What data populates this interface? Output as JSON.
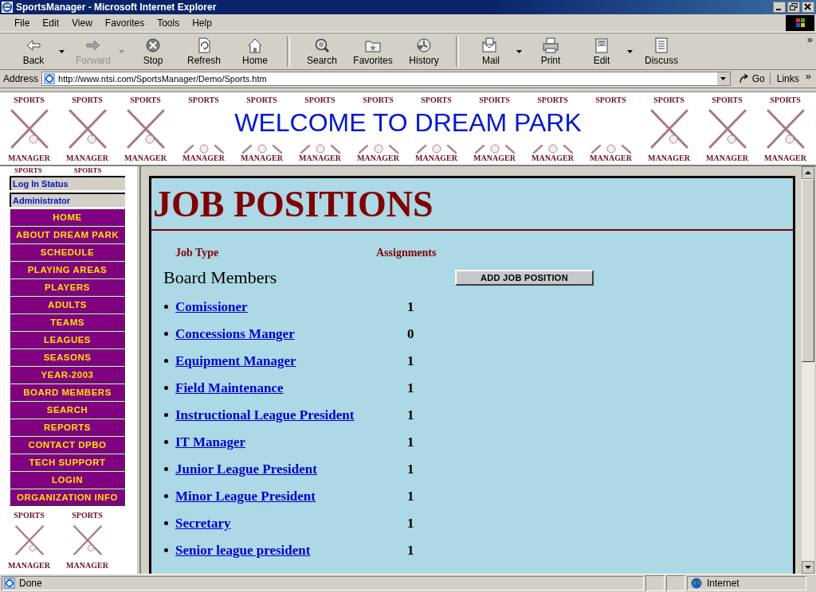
{
  "window": {
    "title": "SportsManager - Microsoft Internet Explorer"
  },
  "menu": [
    "File",
    "Edit",
    "View",
    "Favorites",
    "Tools",
    "Help"
  ],
  "toolbar": [
    {
      "label": "Back",
      "disabled": false,
      "dropdown": true,
      "group_end": false
    },
    {
      "label": "Forward",
      "disabled": true,
      "dropdown": true,
      "group_end": false
    },
    {
      "label": "Stop",
      "disabled": false,
      "dropdown": false,
      "group_end": false
    },
    {
      "label": "Refresh",
      "disabled": false,
      "dropdown": false,
      "group_end": false
    },
    {
      "label": "Home",
      "disabled": false,
      "dropdown": false,
      "group_end": true
    },
    {
      "label": "Search",
      "disabled": false,
      "dropdown": false,
      "group_end": false
    },
    {
      "label": "Favorites",
      "disabled": false,
      "dropdown": false,
      "group_end": false
    },
    {
      "label": "History",
      "disabled": false,
      "dropdown": false,
      "group_end": true
    },
    {
      "label": "Mail",
      "disabled": false,
      "dropdown": true,
      "group_end": false
    },
    {
      "label": "Print",
      "disabled": false,
      "dropdown": false,
      "group_end": false
    },
    {
      "label": "Edit",
      "disabled": false,
      "dropdown": true,
      "group_end": false
    },
    {
      "label": "Discuss",
      "disabled": false,
      "dropdown": false,
      "group_end": false
    }
  ],
  "toolbar_more": "»",
  "address_bar": {
    "label": "Address",
    "value": "http://www.ntsi.com/SportsManager/Demo/Sports.htm",
    "go": "Go",
    "links": "Links",
    "links_more": "»"
  },
  "banner": {
    "title": "WELCOME TO DREAM PARK",
    "tiles": [
      {
        "top": "SPORTS",
        "bottom": "MANAGER",
        "kind": "full"
      },
      {
        "top": "SPORTS",
        "bottom": "MANAGER",
        "kind": "full"
      },
      {
        "top": "SPORTS",
        "bottom": "MANAGER",
        "kind": "full"
      },
      {
        "top": "SPORTS",
        "bottom": "MANAGER",
        "kind": "small"
      },
      {
        "top": "SPORTS",
        "bottom": "MANAGER",
        "kind": "small"
      },
      {
        "top": "SPORTS",
        "bottom": "MANAGER",
        "kind": "small"
      },
      {
        "top": "SPORTS",
        "bottom": "MANAGER",
        "kind": "small"
      },
      {
        "top": "SPORTS",
        "bottom": "MANAGER",
        "kind": "small"
      },
      {
        "top": "SPORTS",
        "bottom": "MANAGER",
        "kind": "small"
      },
      {
        "top": "SPORTS",
        "bottom": "MANAGER",
        "kind": "small"
      },
      {
        "top": "SPORTS",
        "bottom": "MANAGER",
        "kind": "small"
      },
      {
        "top": "SPORTS",
        "bottom": "MANAGER",
        "kind": "full"
      },
      {
        "top": "SPORTS",
        "bottom": "MANAGER",
        "kind": "full"
      },
      {
        "top": "SPORTS",
        "bottom": "MANAGER",
        "kind": "full"
      }
    ]
  },
  "sidebar": {
    "top_tiles": [
      "SPORTS",
      "SPORTS"
    ],
    "status": [
      {
        "text": "Log In Status"
      },
      {
        "text": "Administrator"
      }
    ],
    "items": [
      "HOME",
      "ABOUT DREAM PARK",
      "SCHEDULE",
      "PLAYING AREAS",
      "PLAYERS",
      "ADULTS",
      "TEAMS",
      "LEAGUES",
      "SEASONS",
      "YEAR-2003",
      "BOARD MEMBERS",
      "SEARCH",
      "REPORTS",
      "CONTACT DPBO",
      "TECH SUPPORT",
      "LOGIN",
      "ORGANIZATION INFO"
    ],
    "bottom_tiles": [
      {
        "top": "SPORTS",
        "bottom": "MANAGER"
      },
      {
        "top": "SPORTS",
        "bottom": "MANAGER"
      }
    ]
  },
  "content": {
    "title": "JOB POSITIONS",
    "columns": [
      "Job Type",
      "Assignments"
    ],
    "section": "Board Members",
    "add_button": "ADD JOB POSITION",
    "positions": [
      {
        "name": "Comissioner",
        "count": "1"
      },
      {
        "name": "Concessions Manger",
        "count": "0"
      },
      {
        "name": "Equipment Manager",
        "count": "1"
      },
      {
        "name": "Field Maintenance",
        "count": "1"
      },
      {
        "name": "Instructional League President",
        "count": "1"
      },
      {
        "name": "IT Manager",
        "count": "1"
      },
      {
        "name": "Junior League President",
        "count": "1"
      },
      {
        "name": "Minor League President",
        "count": "1"
      },
      {
        "name": "Secretary",
        "count": "1"
      },
      {
        "name": "Senior league president",
        "count": "1"
      }
    ]
  },
  "status_bar": {
    "text": "Done",
    "zone": "Internet"
  }
}
